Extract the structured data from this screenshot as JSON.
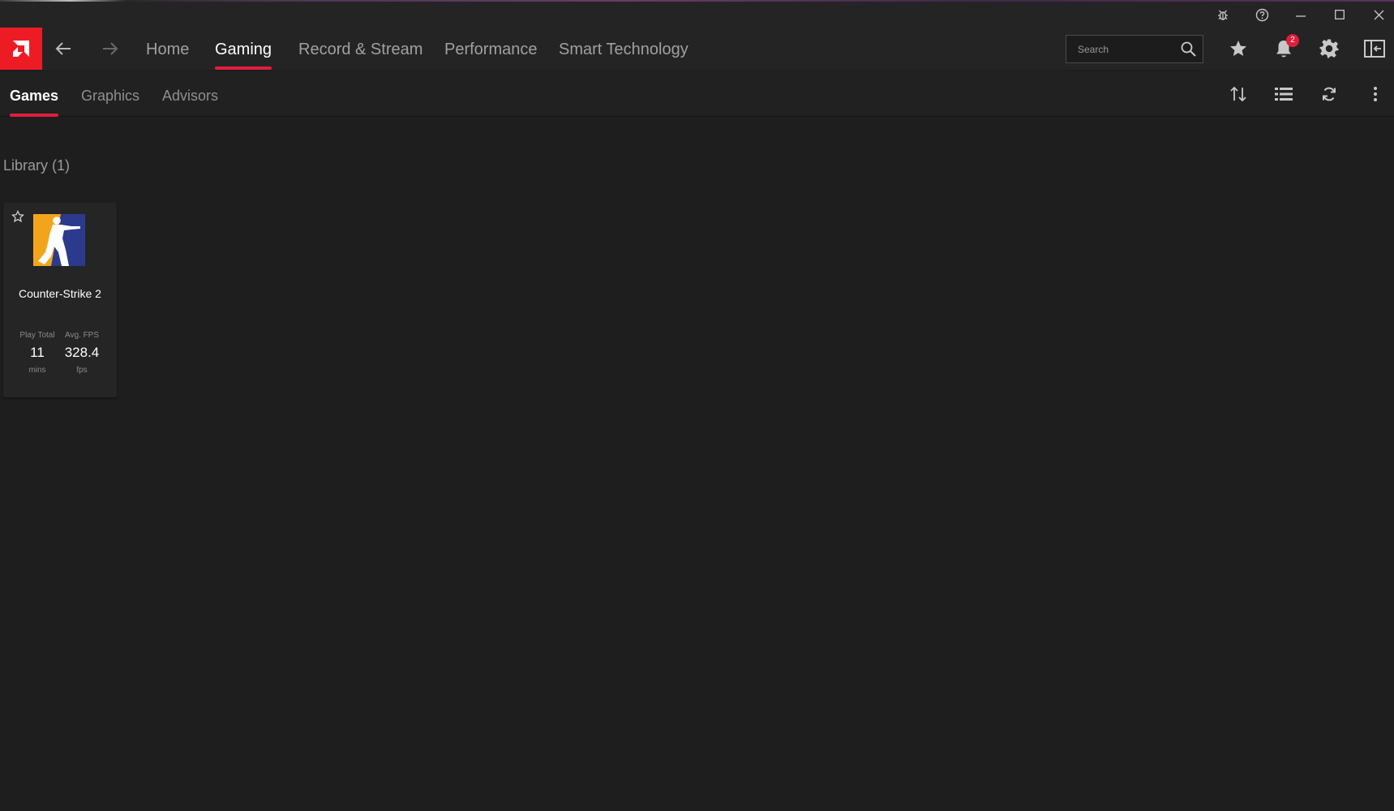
{
  "app": {
    "brand_color": "#ed1c24",
    "accent_color": "#e01e3c"
  },
  "title_bar": {
    "icons": [
      "bug-report-icon",
      "help-icon",
      "minimize-icon",
      "maximize-icon",
      "close-icon"
    ]
  },
  "main_nav": {
    "tabs": [
      {
        "label": "Home"
      },
      {
        "label": "Gaming",
        "active": true
      },
      {
        "label": "Record & Stream"
      },
      {
        "label": "Performance"
      },
      {
        "label": "Smart Technology"
      }
    ]
  },
  "search": {
    "placeholder": "Search"
  },
  "notifications": {
    "count": "2"
  },
  "sub_nav": {
    "tabs": [
      {
        "label": "Games",
        "active": true
      },
      {
        "label": "Graphics"
      },
      {
        "label": "Advisors"
      }
    ]
  },
  "library": {
    "title": "Library (1)",
    "games": [
      {
        "name": "Counter-Strike 2",
        "stats": [
          {
            "label": "Play Total",
            "value": "11",
            "unit": "mins"
          },
          {
            "label": "Avg. FPS",
            "value": "328.4",
            "unit": "fps"
          }
        ]
      }
    ]
  }
}
